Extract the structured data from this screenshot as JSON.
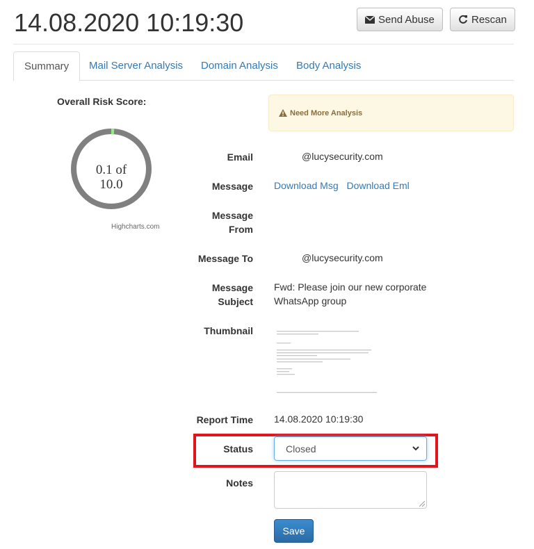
{
  "header": {
    "title": "14.08.2020 10:19:30",
    "send_abuse_label": "Send Abuse",
    "rescan_label": "Rescan"
  },
  "tabs": [
    {
      "label": "Summary",
      "active": true
    },
    {
      "label": "Mail Server Analysis",
      "active": false
    },
    {
      "label": "Domain Analysis",
      "active": false
    },
    {
      "label": "Body Analysis",
      "active": false
    }
  ],
  "risk": {
    "label": "Overall Risk Score:",
    "score_line1": "0.1 of",
    "score_line2": "10.0",
    "score": 0.1,
    "max": 10.0,
    "credit": "Highcharts.com",
    "ring_color": "#808080",
    "value_color": "#90ee7e"
  },
  "alert": {
    "text": "Need More Analysis"
  },
  "details": {
    "email_label": "Email",
    "email_value": "@lucysecurity.com",
    "message_label": "Message",
    "download_msg": "Download Msg",
    "download_eml": "Download Eml",
    "message_from_label_1": "Message",
    "message_from_label_2": "From",
    "message_to_label": "Message To",
    "message_to_value": "@lucysecurity.com",
    "subject_label_1": "Message",
    "subject_label_2": "Subject",
    "subject_value_1": "Fwd: Please join our new corporate",
    "subject_value_2": "WhatsApp group",
    "thumbnail_label": "Thumbnail",
    "report_time_label": "Report Time",
    "report_time_value": "14.08.2020 10:19:30"
  },
  "form": {
    "status_label": "Status",
    "status_value": "Closed",
    "notes_label": "Notes",
    "save_label": "Save"
  }
}
